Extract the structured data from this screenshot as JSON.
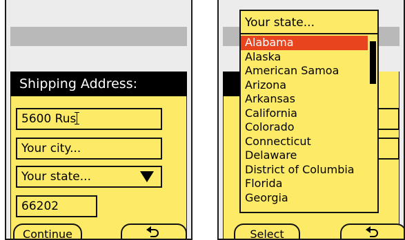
{
  "left_screen": {
    "header": "Shipping Address:",
    "street_value": "5600 Rus",
    "city_placeholder": "Your city...",
    "state_value": "Your state...",
    "zip_value": "66202",
    "left_softkey": "Continue",
    "right_softkey_icon": "return-icon"
  },
  "right_screen": {
    "dropdown_header": "Your state...",
    "states": [
      "Alabama",
      "Alaska",
      "American Samoa",
      "Arizona",
      "Arkansas",
      "California",
      "Colorado",
      "Connecticut",
      "Delaware",
      "District of Columbia",
      "Florida",
      "Georgia"
    ],
    "selected_index": 0,
    "left_softkey": "Select",
    "right_softkey_icon": "return-icon"
  },
  "colors": {
    "form_yellow": "#fdeb68",
    "highlight": "#e8451e",
    "header_bg": "#000000",
    "grey_bar": "#b9b9b9"
  }
}
